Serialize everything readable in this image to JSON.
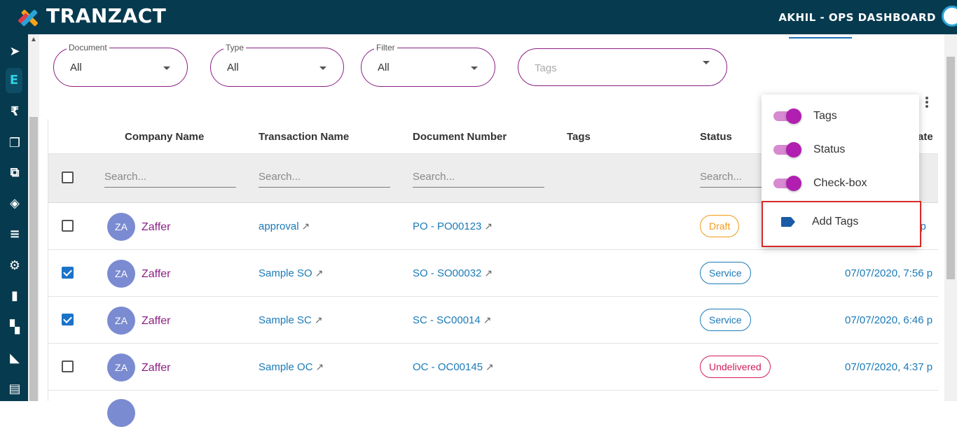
{
  "header": {
    "brand": "TRANZACT",
    "user": "AKHIL - OPS DASHBOARD"
  },
  "sidebar": {
    "icons": [
      "send-icon",
      "ledger-icon",
      "rupee-icon",
      "documents-icon",
      "copy-icon",
      "box-icon",
      "fast-list-icon",
      "settings-icon",
      "book-icon",
      "map-icon",
      "chart-icon",
      "shelf-icon"
    ]
  },
  "filters": {
    "document": {
      "label": "Document",
      "value": "All"
    },
    "type": {
      "label": "Type",
      "value": "All"
    },
    "filter": {
      "label": "Filter",
      "value": "All"
    },
    "tags": {
      "placeholder": "Tags"
    }
  },
  "table": {
    "columns": {
      "company": "Company Name",
      "transaction": "Transaction Name",
      "document": "Document Number",
      "tags": "Tags",
      "status": "Status",
      "date": "ate"
    },
    "search_placeholder": "Search...",
    "rows": [
      {
        "initials": "ZA",
        "company": "Zaffer",
        "transaction": "approval",
        "document": "PO - PO00123",
        "status": "Draft",
        "date": "4 p",
        "checked": false
      },
      {
        "initials": "ZA",
        "company": "Zaffer",
        "transaction": "Sample SO",
        "document": "SO - SO00032",
        "status": "Service",
        "date": "07/07/2020, 7:56 p",
        "checked": true
      },
      {
        "initials": "ZA",
        "company": "Zaffer",
        "transaction": "Sample SC",
        "document": "SC - SC00014",
        "status": "Service",
        "date": "07/07/2020, 6:46 p",
        "checked": true
      },
      {
        "initials": "ZA",
        "company": "Zaffer",
        "transaction": "Sample OC",
        "document": "OC - OC00145",
        "status": "Undelivered",
        "date": "07/07/2020, 4:37 p",
        "checked": false
      }
    ],
    "ext_icon": "↗"
  },
  "menu": {
    "items": [
      {
        "label": "Tags",
        "on": true
      },
      {
        "label": "Status",
        "on": true
      },
      {
        "label": "Check-box",
        "on": true
      }
    ],
    "add_tags": "Add Tags"
  },
  "colors": {
    "header": "#063a4f",
    "accent": "#8b1f83",
    "link": "#1a7ab8",
    "highlight": "#d62a2a"
  }
}
